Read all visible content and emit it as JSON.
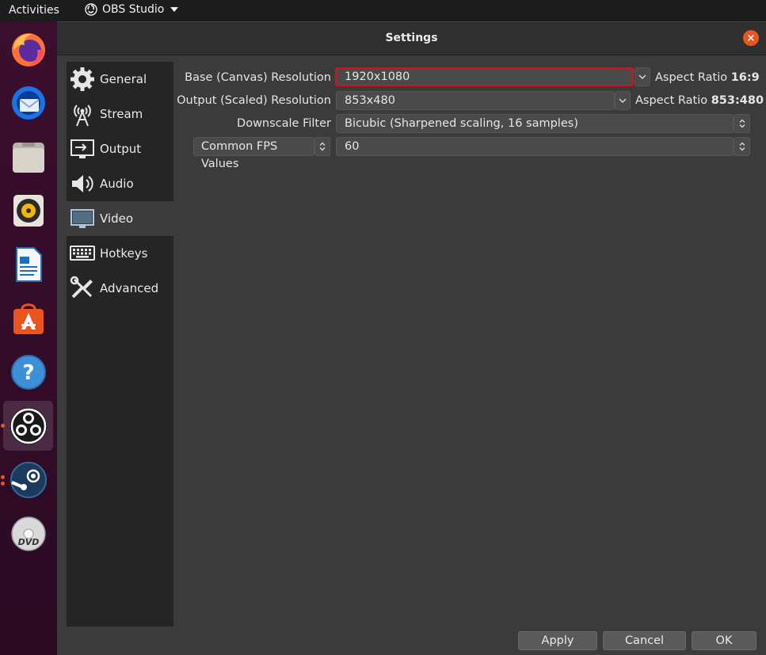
{
  "topbar": {
    "activities": "Activities",
    "app_name": "OBS Studio"
  },
  "dock": {
    "items": [
      "firefox-icon",
      "thunderbird-icon",
      "files-icon",
      "rhythmbox-icon",
      "libreoffice-writer-icon",
      "ubuntu-software-icon",
      "help-icon",
      "obs-studio-icon",
      "steam-icon",
      "dvd-icon"
    ]
  },
  "window": {
    "title": "Settings",
    "close_glyph": "×"
  },
  "sidebar": {
    "items": [
      {
        "label": "General",
        "icon": "gear-icon"
      },
      {
        "label": "Stream",
        "icon": "antenna-icon"
      },
      {
        "label": "Output",
        "icon": "output-icon"
      },
      {
        "label": "Audio",
        "icon": "speaker-icon"
      },
      {
        "label": "Video",
        "icon": "monitor-icon"
      },
      {
        "label": "Hotkeys",
        "icon": "keyboard-icon"
      },
      {
        "label": "Advanced",
        "icon": "tools-icon"
      }
    ],
    "selected": "Video"
  },
  "video": {
    "base_resolution": {
      "label": "Base (Canvas) Resolution",
      "value": "1920x1080",
      "aspect_prefix": "Aspect Ratio",
      "aspect_value": "16:9"
    },
    "output_resolution": {
      "label": "Output (Scaled) Resolution",
      "value": "853x480",
      "aspect_prefix": "Aspect Ratio",
      "aspect_value": "853:480"
    },
    "downscale_filter": {
      "label": "Downscale Filter",
      "value": "Bicubic (Sharpened scaling, 16 samples)"
    },
    "fps": {
      "label": "Common FPS Values",
      "value": "60"
    }
  },
  "buttons": {
    "apply": "Apply",
    "cancel": "Cancel",
    "ok": "OK"
  },
  "colors": {
    "accent": "#e95420",
    "highlight_border": "#d4141c"
  }
}
